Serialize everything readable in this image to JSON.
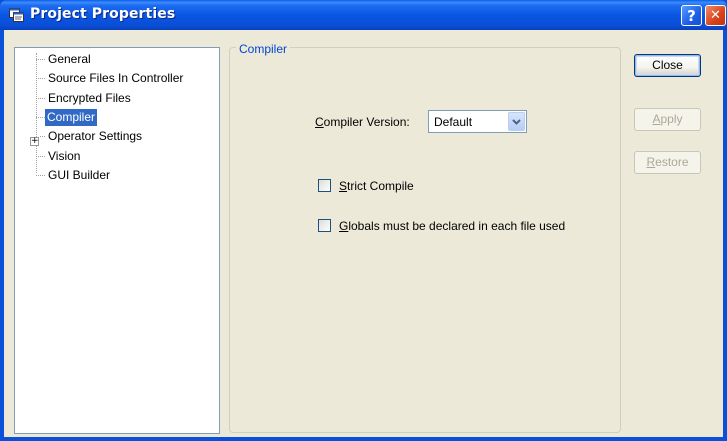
{
  "window": {
    "title": "Project Properties",
    "help_label": "?",
    "close_label": "✕"
  },
  "tree": {
    "items": [
      {
        "label": "General",
        "selected": false,
        "expandable": false
      },
      {
        "label": "Source Files In Controller",
        "selected": false,
        "expandable": false
      },
      {
        "label": "Encrypted Files",
        "selected": false,
        "expandable": false
      },
      {
        "label": "Compiler",
        "selected": true,
        "expandable": false
      },
      {
        "label": "Operator Settings",
        "selected": false,
        "expandable": true
      },
      {
        "label": "Vision",
        "selected": false,
        "expandable": false
      },
      {
        "label": "GUI Builder",
        "selected": false,
        "expandable": false
      }
    ],
    "expander_symbol": "+"
  },
  "compiler": {
    "group_label": "Compiler",
    "version_label_accel": "C",
    "version_label_rest": "ompiler Version:",
    "version_value": "Default",
    "strict_accel": "S",
    "strict_rest": "trict Compile",
    "strict_checked": false,
    "globals_accel": "G",
    "globals_rest": "lobals must be declared in each file used",
    "globals_checked": false
  },
  "buttons": {
    "close": "Close",
    "apply_accel": "A",
    "apply_rest": "pply",
    "apply_enabled": false,
    "restore_accel": "R",
    "restore_rest": "estore",
    "restore_enabled": false
  },
  "colors": {
    "titlebar": "#0a56e4",
    "selection": "#316ac5",
    "group_label": "#0046d5",
    "dialog_bg": "#ece9d8"
  }
}
